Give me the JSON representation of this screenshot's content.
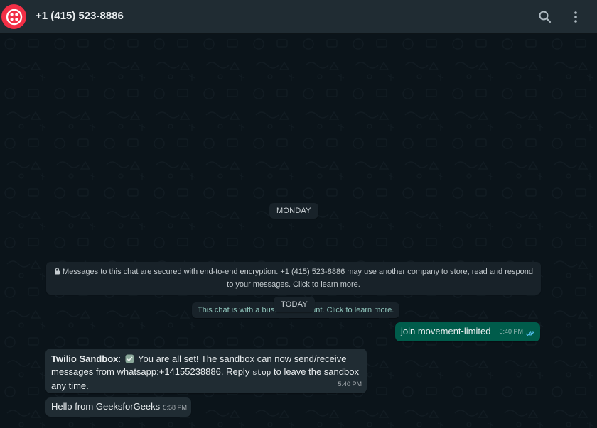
{
  "header": {
    "contact_name": "+1 (415) 523-8886",
    "avatar_color": "#f22f46",
    "icons": [
      "search-icon",
      "more-vertical-icon"
    ]
  },
  "chat": {
    "day_monday": "MONDAY",
    "encryption_notice": "Messages to this chat are secured with end-to-end encryption. +1 (415) 523-8886 may use another company to store, read and respond to your messages. Click to learn more.",
    "business_notice": "This chat is with a business account. Click to learn more.",
    "day_today": "TODAY",
    "messages": [
      {
        "direction": "outgoing",
        "text": "join movement-limited",
        "time": "5:40 PM",
        "status": "read"
      },
      {
        "direction": "incoming",
        "sender": "Twilio Sandbox",
        "text_part1": "You are all set! The sandbox can now send/receive messages from whatsapp:+14155238886. Reply",
        "code": "stop",
        "text_part2": "to leave the sandbox any time.",
        "time": "5:40 PM"
      },
      {
        "direction": "incoming",
        "text": "Hello from GeeksforGeeks",
        "time": "5:58 PM"
      }
    ]
  },
  "colors": {
    "header_bg": "#202c33",
    "chat_bg": "#0b141a",
    "outgoing_bubble": "#005c4b",
    "incoming_bubble": "#202c33",
    "read_ticks": "#53bdeb"
  }
}
